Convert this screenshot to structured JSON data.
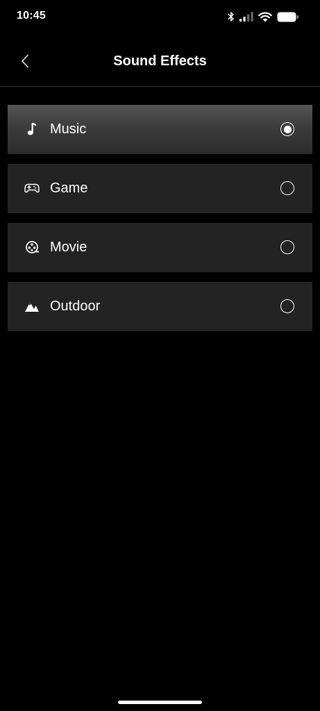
{
  "status_bar": {
    "time": "10:45",
    "icons": [
      "bluetooth-icon",
      "signal-icon",
      "wifi-icon",
      "battery-icon"
    ]
  },
  "header": {
    "title": "Sound Effects",
    "back_icon": "chevron-left-icon"
  },
  "options": [
    {
      "label": "Music",
      "icon": "music-note-icon",
      "selected": true
    },
    {
      "label": "Game",
      "icon": "gamepad-icon",
      "selected": false
    },
    {
      "label": "Movie",
      "icon": "film-reel-icon",
      "selected": false
    },
    {
      "label": "Outdoor",
      "icon": "mountain-icon",
      "selected": false
    }
  ],
  "colors": {
    "background": "#000000",
    "row": "#232323",
    "row_selected_top": "#555555",
    "text": "#ffffff"
  }
}
